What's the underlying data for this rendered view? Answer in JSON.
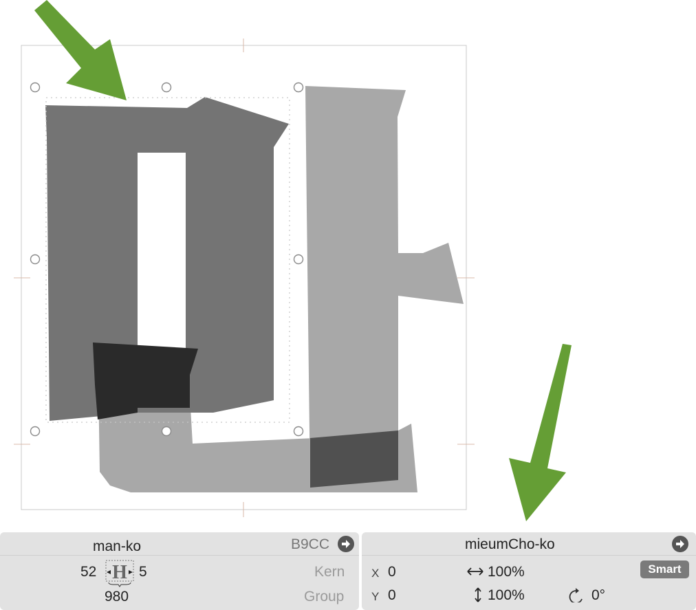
{
  "glyph_panel": {
    "name": "man-ko",
    "unicode": "B9CC",
    "lsb": "52",
    "rsb": "5",
    "width": "980",
    "kern_label": "Kern",
    "group_label": "Group"
  },
  "component_panel": {
    "name": "mieumCho-ko",
    "x_label": "X",
    "x_value": "0",
    "y_label": "Y",
    "y_value": "0",
    "scale_x": "100%",
    "scale_y": "100%",
    "rotation": "0°",
    "smart_label": "Smart"
  },
  "colors": {
    "annotation_arrow": "#659e35",
    "selected_component": "#747474",
    "glyph_fill": "#a8a8a8",
    "overlap": "#2a2a2a"
  },
  "icons": {
    "metrics_glyph": "H",
    "goto": "arrow-right-circle-icon",
    "scale_horizontal": "horizontal-arrows-icon",
    "scale_vertical": "vertical-arrows-icon",
    "rotate": "rotate-icon"
  }
}
